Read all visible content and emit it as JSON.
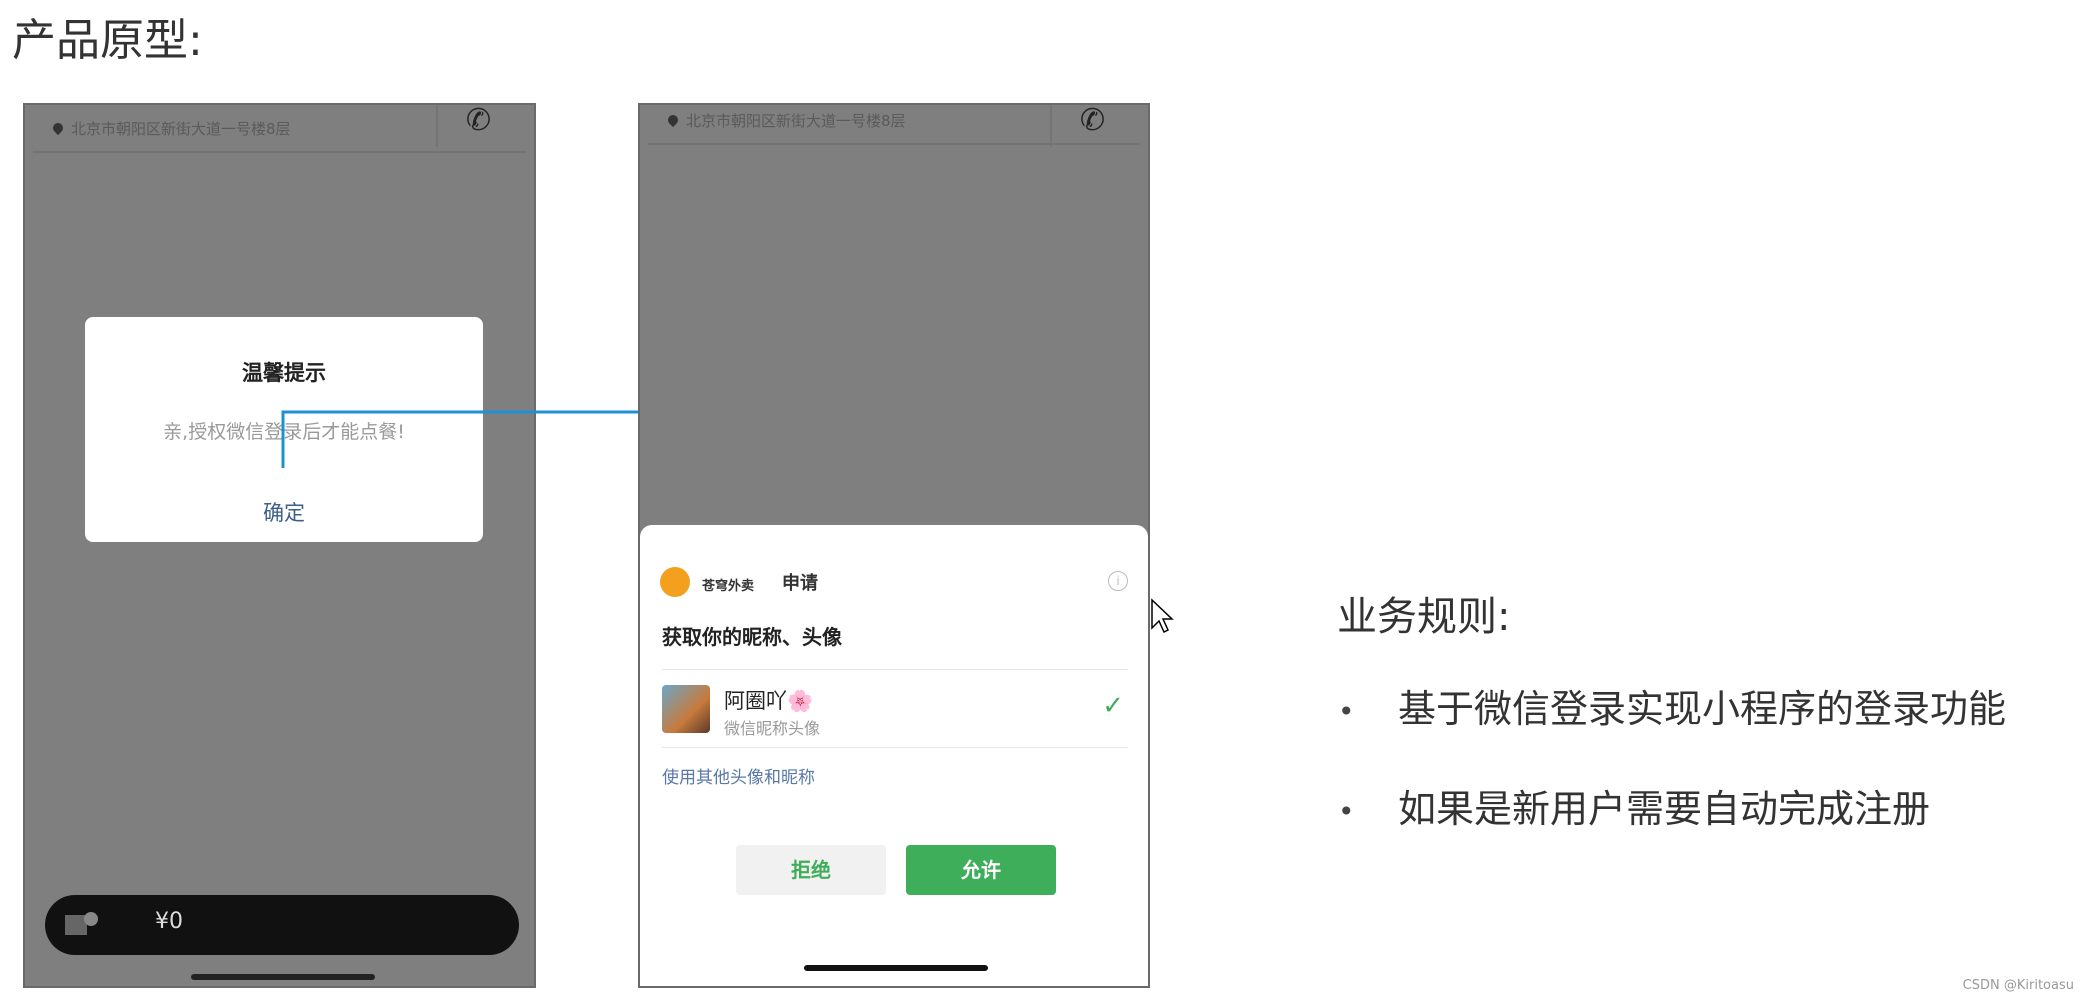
{
  "page_title": "产品原型:",
  "phone1": {
    "address": "北京市朝阳区新街大道一号楼8层",
    "dialog": {
      "title": "温馨提示",
      "message": "亲,授权微信登录后才能点餐!",
      "confirm": "确定"
    },
    "cart": {
      "amount": "¥0"
    }
  },
  "phone2": {
    "address": "北京市朝阳区新街大道一号楼8层",
    "auth": {
      "app_name": "苍穹外卖",
      "apply": "申请",
      "heading": "获取你的昵称、头像",
      "nickname": "阿圈吖🌸",
      "nickname_sub": "微信昵称头像",
      "other_option": "使用其他头像和昵称",
      "deny": "拒绝",
      "allow": "允许"
    }
  },
  "rules": {
    "title": "业务规则:",
    "items": [
      "基于微信登录实现小程序的登录功能",
      "如果是新用户需要自动完成注册"
    ]
  },
  "watermark": "CSDN @Kiritoasu",
  "colors": {
    "accent_green": "#3fae5a",
    "arrow_blue": "#1e90d6",
    "overlay_gray": "#7f7f7f"
  }
}
